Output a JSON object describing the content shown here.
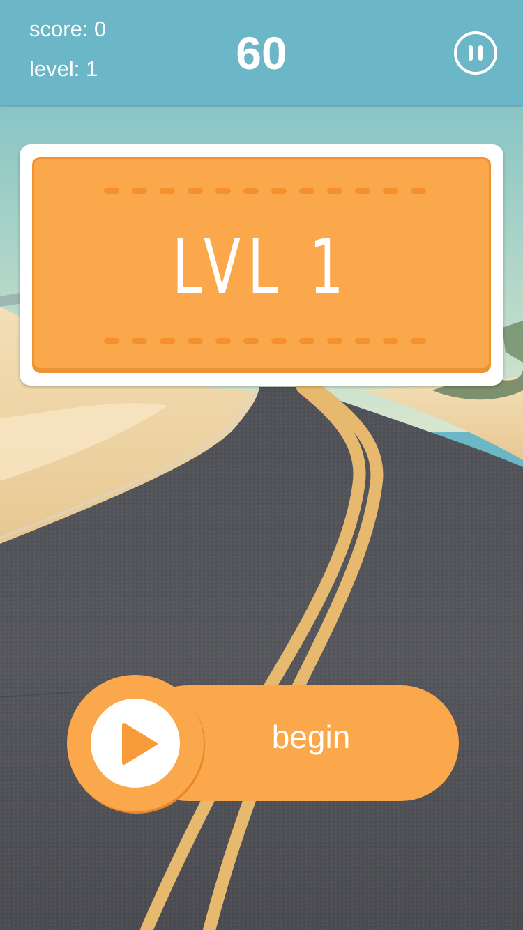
{
  "hud": {
    "score_text": "score: 0",
    "level_text": "level: 1",
    "timer": "60",
    "pause_icon": "pause-icon"
  },
  "level_card": {
    "title": "LVL 1"
  },
  "begin_button": {
    "label": "begin",
    "icon": "play-icon"
  },
  "colors": {
    "topbar": "#6cb7c7",
    "accent_orange": "#fba74b",
    "accent_orange_dark": "#f4912d",
    "text": "#ffffff"
  }
}
